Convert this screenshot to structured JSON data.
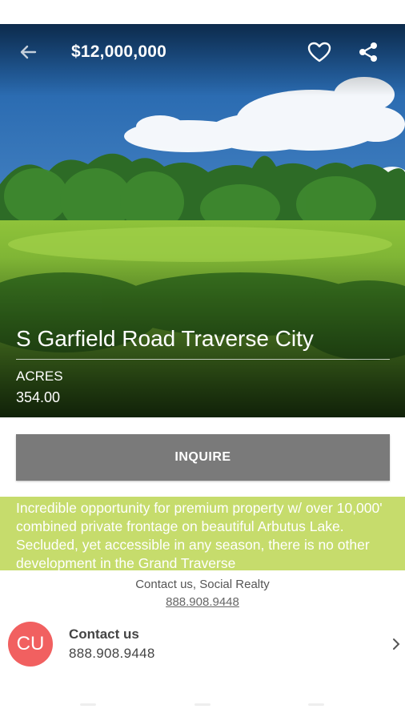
{
  "header": {
    "price": "$12,000,000",
    "back_icon": "arrow-left-icon",
    "favorite_icon": "heart-outline-icon",
    "share_icon": "share-icon"
  },
  "property": {
    "title": "S Garfield Road Traverse City",
    "acres_label": "ACRES",
    "acres_value": "354.00"
  },
  "actions": {
    "inquire_label": "INQUIRE"
  },
  "description": {
    "text": "Incredible opportunity for premium property w/ over 10,000' combined private frontage on beautiful Arbutus Lake. Secluded, yet accessible in any season, there is no other development in the Grand Traverse"
  },
  "contact_bar": {
    "line": "Contact us, Social Realty",
    "phone": "888.908.9448"
  },
  "contact_card": {
    "avatar_initials": "CU",
    "name": "Contact us",
    "phone": "888.908.9448",
    "chevron_icon": "chevron-right-icon"
  },
  "colors": {
    "description_bg": "#c6dc6c",
    "inquire_bg": "#7a7a7a",
    "avatar_bg": "#f16060"
  }
}
